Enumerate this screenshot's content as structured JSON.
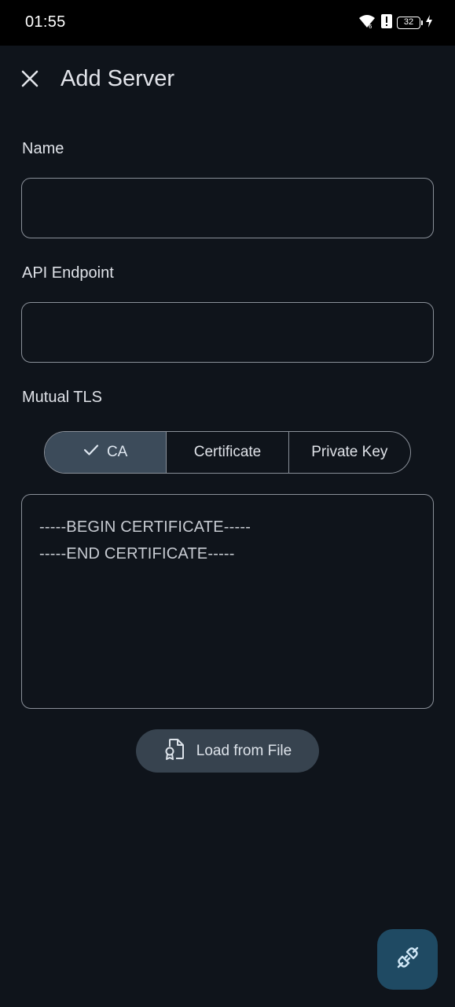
{
  "status_bar": {
    "time": "01:55",
    "battery_level": "32",
    "icons": [
      "wifi-icon",
      "alert-icon",
      "battery-icon",
      "charging-icon"
    ]
  },
  "app_bar": {
    "title": "Add Server",
    "close_icon": "close-icon"
  },
  "form": {
    "name": {
      "label": "Name",
      "value": "",
      "placeholder": ""
    },
    "api_endpoint": {
      "label": "API Endpoint",
      "value": "",
      "placeholder": ""
    },
    "mutual_tls": {
      "label": "Mutual TLS",
      "segments": [
        {
          "label": "CA",
          "selected": true,
          "icon": "check-icon"
        },
        {
          "label": "Certificate",
          "selected": false
        },
        {
          "label": "Private Key",
          "selected": false
        }
      ],
      "pem_text": {
        "line1": "-----BEGIN CERTIFICATE-----",
        "line2": "-----END CERTIFICATE-----"
      }
    },
    "load_button": {
      "label": "Load from File",
      "icon": "certificate-file-icon"
    }
  },
  "fab": {
    "icon": "plug-connect-icon"
  },
  "colors": {
    "background": "#0f141b",
    "selected_segment": "#3c4b5a",
    "button_bg": "#37434f",
    "fab_bg": "#1f4a63",
    "outline": "#8a9099"
  }
}
